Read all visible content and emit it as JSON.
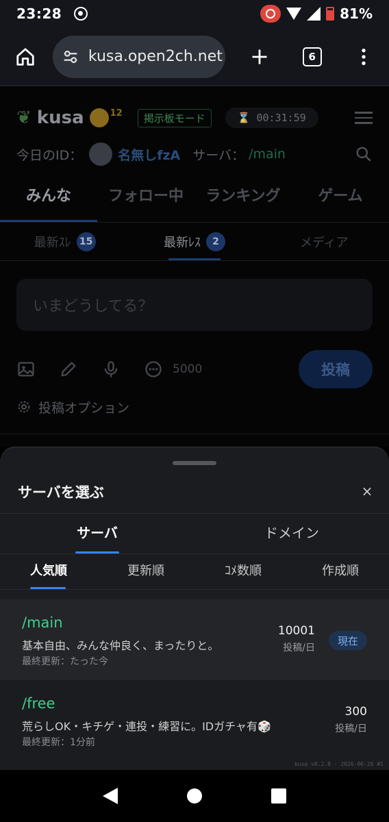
{
  "status": {
    "time": "23:28",
    "battery": "81%"
  },
  "browser": {
    "url": "kusa.open2ch.net",
    "tab_count": "6"
  },
  "site": {
    "logo": "kusa",
    "face_badge": "12",
    "mode_badge": "掲示板モード",
    "timer": "00:31:59",
    "id_label": "今日のID：",
    "user_name": "名無しfzA",
    "server_label": "サーバ：",
    "server_value": "/main",
    "tabs": [
      "みんな",
      "フォロー中",
      "ランキング",
      "ゲーム"
    ],
    "subtabs": [
      {
        "label": "最新ｽﾚ",
        "count": "15"
      },
      {
        "label": "最新ﾚｽ",
        "count": "2"
      },
      {
        "label": "メディア"
      }
    ],
    "compose_placeholder": "いまどうしてる？",
    "char_count": "5000",
    "post_button": "投稿",
    "post_options": "投稿オプション"
  },
  "sheet": {
    "title": "サーバを選ぶ",
    "close": "×",
    "tabs": [
      "サーバ",
      "ドメイン"
    ],
    "sort_tabs": [
      "人気順",
      "更新順",
      "ｺﾒ数順",
      "作成順"
    ],
    "servers": [
      {
        "name": "/main",
        "desc": "基本自由、みんな仲良く、まったりと。",
        "updated": "最終更新：たった今",
        "posts": "10001",
        "unit": "投稿/日",
        "badge": "現在"
      },
      {
        "name": "/free",
        "desc": "荒らしOK・キチゲ・連投・練習に。IDガチャ有🎲",
        "updated": "最終更新：1分前",
        "posts": "300",
        "unit": "投稿/日"
      }
    ],
    "version": "kusa v0.2.8 · 2026-06-26 #1"
  }
}
